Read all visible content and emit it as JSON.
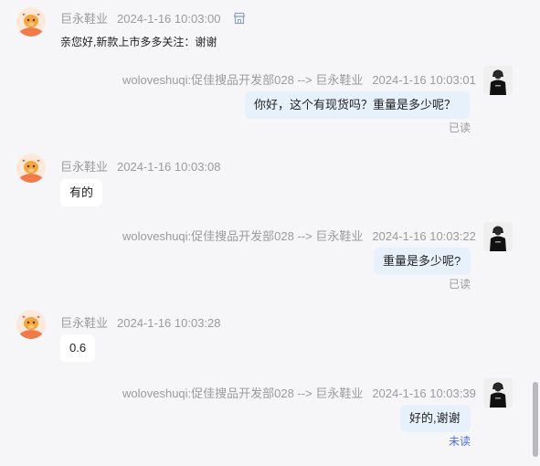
{
  "messages": [
    {
      "side": "left",
      "sender": "巨永鞋业",
      "time": "2024-1-16 10:03:00",
      "text": "亲您好,新款上市多多关注：谢谢",
      "icon": "shop-icon"
    },
    {
      "side": "right",
      "sender": "woloveshuqi:促佳搜品开发部028 --> 巨永鞋业",
      "time": "2024-1-16 10:03:01",
      "text": "你好，这个有现货吗？重量是多少呢？",
      "status": "已读"
    },
    {
      "side": "left",
      "sender": "巨永鞋业",
      "time": "2024-1-16 10:03:08",
      "text": "有的"
    },
    {
      "side": "right",
      "sender": "woloveshuqi:促佳搜品开发部028 --> 巨永鞋业",
      "time": "2024-1-16 10:03:22",
      "text": "重量是多少呢?",
      "status": "已读"
    },
    {
      "side": "left",
      "sender": "巨永鞋业",
      "time": "2024-1-16 10:03:28",
      "text": "0.6"
    },
    {
      "side": "right",
      "sender": "woloveshuqi:促佳搜品开发部028 --> 巨永鞋业",
      "time": "2024-1-16 10:03:39",
      "text": "好的,谢谢",
      "status": "未读"
    }
  ],
  "colors": {
    "background": "#f6f6f8",
    "right_bubble": "#e7f1fc",
    "left_bubble": "#ffffff",
    "meta_text": "#9b9b9b",
    "unread": "#4a6ee0",
    "bot_avatar": "#f07a4a"
  }
}
